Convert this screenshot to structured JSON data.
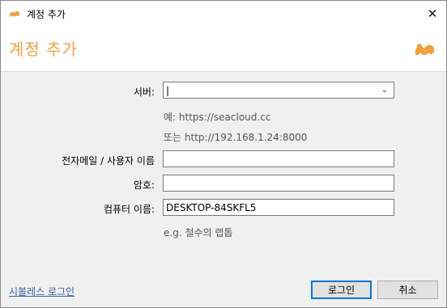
{
  "window": {
    "title": "계정 추가",
    "close_glyph": "✕"
  },
  "header": {
    "heading": "계정 추가"
  },
  "form": {
    "server": {
      "label": "서버:",
      "value": "|",
      "hints": [
        "예: https://seacloud.cc",
        "또는 http://192.168.1.24:8000"
      ]
    },
    "email": {
      "label": "전자메일 / 사용자 이름",
      "value": ""
    },
    "password": {
      "label": "암호:",
      "value": ""
    },
    "computer": {
      "label": "컴퓨터 이름:",
      "value": "DESKTOP-84SKFL5",
      "hint": "e.g. 철수의 랩톱"
    }
  },
  "footer": {
    "shibboleth_link": "시볼레스 로그인",
    "login_button": "로그인",
    "cancel_button": "취소"
  },
  "icons": {
    "app": "seafile-icon",
    "logo": "seafile-logo-icon",
    "dropdown": "chevron-down-icon"
  },
  "colors": {
    "accent": "#f0a040",
    "primary_button_border": "#0078d7",
    "link": "#3b5ea7"
  }
}
